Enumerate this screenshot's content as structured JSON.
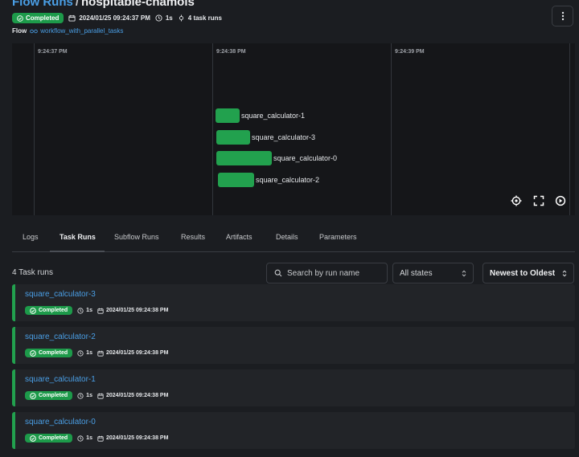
{
  "header": {
    "breadcrumb_link": "Flow Runs",
    "breadcrumb_sep": "/",
    "run_name": "hospitable-chamois",
    "status": "Completed",
    "started": "2024/01/25 09:24:37 PM",
    "duration": "1s",
    "task_runs": "4 task runs",
    "flow_label": "Flow",
    "flow_name": "workflow_with_parallel_tasks"
  },
  "graph": {
    "time_labels": [
      "9:24:37 PM",
      "9:24:38 PM",
      "9:24:39 PM"
    ],
    "tasks": [
      {
        "label": "square_calculator-1"
      },
      {
        "label": "square_calculator-3"
      },
      {
        "label": "square_calculator-0"
      },
      {
        "label": "square_calculator-2"
      }
    ],
    "bar_color": "#22a14e"
  },
  "tabs": [
    "Logs",
    "Task Runs",
    "Subflow Runs",
    "Results",
    "Artifacts",
    "Details",
    "Parameters"
  ],
  "active_tab": "Task Runs",
  "filters": {
    "count": "4 Task runs",
    "search_placeholder": "Search by run name",
    "state": "All states",
    "sort": "Newest to Oldest"
  },
  "runs": [
    {
      "name": "square_calculator-3",
      "status": "Completed",
      "duration": "1s",
      "time": "2024/01/25 09:24:38 PM"
    },
    {
      "name": "square_calculator-2",
      "status": "Completed",
      "duration": "1s",
      "time": "2024/01/25 09:24:38 PM"
    },
    {
      "name": "square_calculator-1",
      "status": "Completed",
      "duration": "1s",
      "time": "2024/01/25 09:24:38 PM"
    },
    {
      "name": "square_calculator-0",
      "status": "Completed",
      "duration": "1s",
      "time": "2024/01/25 09:24:38 PM"
    }
  ],
  "colors": {
    "accent": "#4a9fe6",
    "success": "#1d9a4a"
  }
}
